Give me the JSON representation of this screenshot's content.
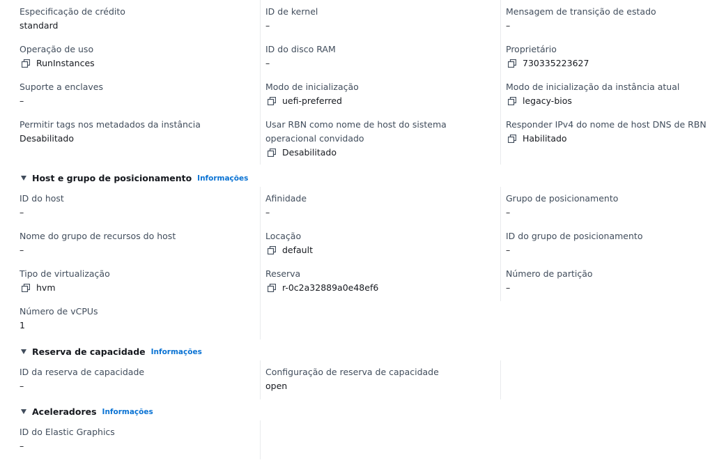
{
  "details": {
    "credit_spec": {
      "label": "Especificação de crédito",
      "value": "standard"
    },
    "kernel_id": {
      "label": "ID de kernel",
      "value": "–"
    },
    "state_msg": {
      "label": "Mensagem de transição de estado",
      "value": "–"
    },
    "usage_op": {
      "label": "Operação de uso",
      "value": "RunInstances"
    },
    "ramdisk_id": {
      "label": "ID do disco RAM",
      "value": "–"
    },
    "owner": {
      "label": "Proprietário",
      "value": "730335223627"
    },
    "enclave": {
      "label": "Suporte a enclaves",
      "value": "–"
    },
    "boot_mode": {
      "label": "Modo de inicialização",
      "value": "uefi-preferred"
    },
    "current_boot_mode": {
      "label": "Modo de inicialização da instância atual",
      "value": "legacy-bios"
    },
    "metadata_tags": {
      "label": "Permitir tags nos metadados da instância",
      "value": "Desabilitado"
    },
    "rbn_hostname": {
      "label": "Usar RBN como nome de host do sistema operacional convidado",
      "value": "Desabilitado"
    },
    "rbn_ipv4": {
      "label": "Responder IPv4 do nome de host DNS de RBN",
      "value": "Habilitado"
    }
  },
  "host_placement": {
    "title": "Host e grupo de posicionamento",
    "info": "Informações",
    "host_id": {
      "label": "ID do host",
      "value": "–"
    },
    "affinity": {
      "label": "Afinidade",
      "value": "–"
    },
    "placement_group": {
      "label": "Grupo de posicionamento",
      "value": "–"
    },
    "host_rg_name": {
      "label": "Nome do grupo de recursos do host",
      "value": "–"
    },
    "tenancy": {
      "label": "Locação",
      "value": "default"
    },
    "placement_group_id": {
      "label": "ID do grupo de posicionamento",
      "value": "–"
    },
    "virt_type": {
      "label": "Tipo de virtualização",
      "value": "hvm"
    },
    "reservation": {
      "label": "Reserva",
      "value": "r-0c2a32889a0e48ef6"
    },
    "partition_num": {
      "label": "Número de partição",
      "value": "–"
    },
    "vcpus": {
      "label": "Número de vCPUs",
      "value": "1"
    }
  },
  "capacity": {
    "title": "Reserva de capacidade",
    "info": "Informações",
    "cr_id": {
      "label": "ID da reserva de capacidade",
      "value": "–"
    },
    "cr_config": {
      "label": "Configuração de reserva de capacidade",
      "value": "open"
    }
  },
  "accelerators": {
    "title": "Aceleradores",
    "info": "Informações",
    "eg_id": {
      "label": "ID do Elastic Graphics",
      "value": "–"
    }
  },
  "icons": {
    "copy": "copy-icon",
    "caret": "caret-down-icon"
  },
  "colors": {
    "link": "#0972d3",
    "label": "#414d5c",
    "text": "#16191f",
    "divider": "#e9ebed"
  }
}
